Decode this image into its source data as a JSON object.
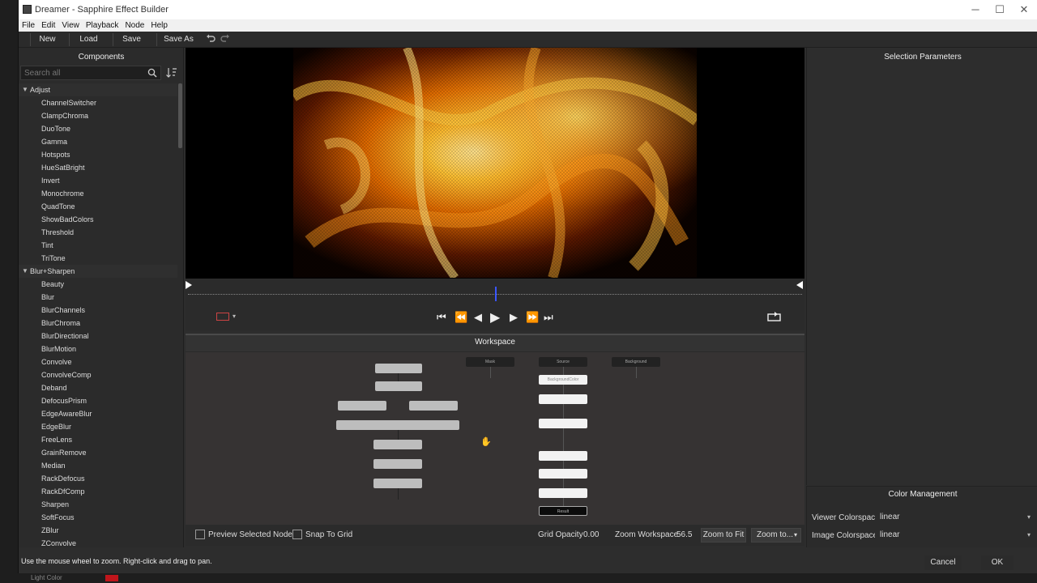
{
  "window": {
    "title": "Dreamer - Sapphire Effect Builder",
    "controls": {
      "minimize": "─",
      "maximize": "☐",
      "close": "✕"
    }
  },
  "menu": [
    "File",
    "Edit",
    "View",
    "Playback",
    "Node",
    "Help"
  ],
  "toolbar": {
    "new_label": "New",
    "load_label": "Load",
    "save_label": "Save",
    "save_as_label": "Save As"
  },
  "components": {
    "title": "Components",
    "search_placeholder": "Search all",
    "tree": [
      {
        "type": "cat",
        "label": "Adjust"
      },
      {
        "type": "item",
        "label": "ChannelSwitcher"
      },
      {
        "type": "item",
        "label": "ClampChroma"
      },
      {
        "type": "item",
        "label": "DuoTone"
      },
      {
        "type": "item",
        "label": "Gamma"
      },
      {
        "type": "item",
        "label": "Hotspots"
      },
      {
        "type": "item",
        "label": "HueSatBright"
      },
      {
        "type": "item",
        "label": "Invert"
      },
      {
        "type": "item",
        "label": "Monochrome"
      },
      {
        "type": "item",
        "label": "QuadTone"
      },
      {
        "type": "item",
        "label": "ShowBadColors"
      },
      {
        "type": "item",
        "label": "Threshold"
      },
      {
        "type": "item",
        "label": "Tint"
      },
      {
        "type": "item",
        "label": "TriTone"
      },
      {
        "type": "cat",
        "label": "Blur+Sharpen"
      },
      {
        "type": "item",
        "label": "Beauty"
      },
      {
        "type": "item",
        "label": "Blur"
      },
      {
        "type": "item",
        "label": "BlurChannels"
      },
      {
        "type": "item",
        "label": "BlurChroma"
      },
      {
        "type": "item",
        "label": "BlurDirectional"
      },
      {
        "type": "item",
        "label": "BlurMotion"
      },
      {
        "type": "item",
        "label": "Convolve"
      },
      {
        "type": "item",
        "label": "ConvolveComp"
      },
      {
        "type": "item",
        "label": "Deband"
      },
      {
        "type": "item",
        "label": "DefocusPrism"
      },
      {
        "type": "item",
        "label": "EdgeAwareBlur"
      },
      {
        "type": "item",
        "label": "EdgeBlur"
      },
      {
        "type": "item",
        "label": "FreeLens"
      },
      {
        "type": "item",
        "label": "GrainRemove"
      },
      {
        "type": "item",
        "label": "Median"
      },
      {
        "type": "item",
        "label": "RackDefocus"
      },
      {
        "type": "item",
        "label": "RackDfComp"
      },
      {
        "type": "item",
        "label": "Sharpen"
      },
      {
        "type": "item",
        "label": "SoftFocus"
      },
      {
        "type": "item",
        "label": "ZBlur"
      },
      {
        "type": "item",
        "label": "ZConvolve"
      }
    ]
  },
  "workspace": {
    "title": "Workspace",
    "nodes": {
      "mask": "Mask",
      "source": "Source",
      "background": "Background",
      "background_color": "BackgroundColor",
      "result": "Result"
    },
    "preview_selected_label": "Preview Selected Node",
    "snap_to_grid_label": "Snap To Grid",
    "grid_opacity_label": "Grid Opacity",
    "grid_opacity_value": "0.00",
    "zoom_workspace_label": "Zoom Workspace",
    "zoom_workspace_value": "56.5",
    "zoom_to_fit_label": "Zoom to Fit",
    "zoom_to_label": "Zoom to..."
  },
  "selection_parameters": {
    "title": "Selection Parameters"
  },
  "color_management": {
    "title": "Color Management",
    "viewer_label": "Viewer Colorspace",
    "viewer_value": "linear",
    "image_label": "Image Colorspace",
    "image_value": "linear"
  },
  "footer": {
    "status": "Use the mouse wheel to zoom.  Right-click and drag to pan.",
    "cancel_label": "Cancel",
    "ok_label": "OK"
  },
  "host": {
    "bottom_text": "Light Color"
  }
}
